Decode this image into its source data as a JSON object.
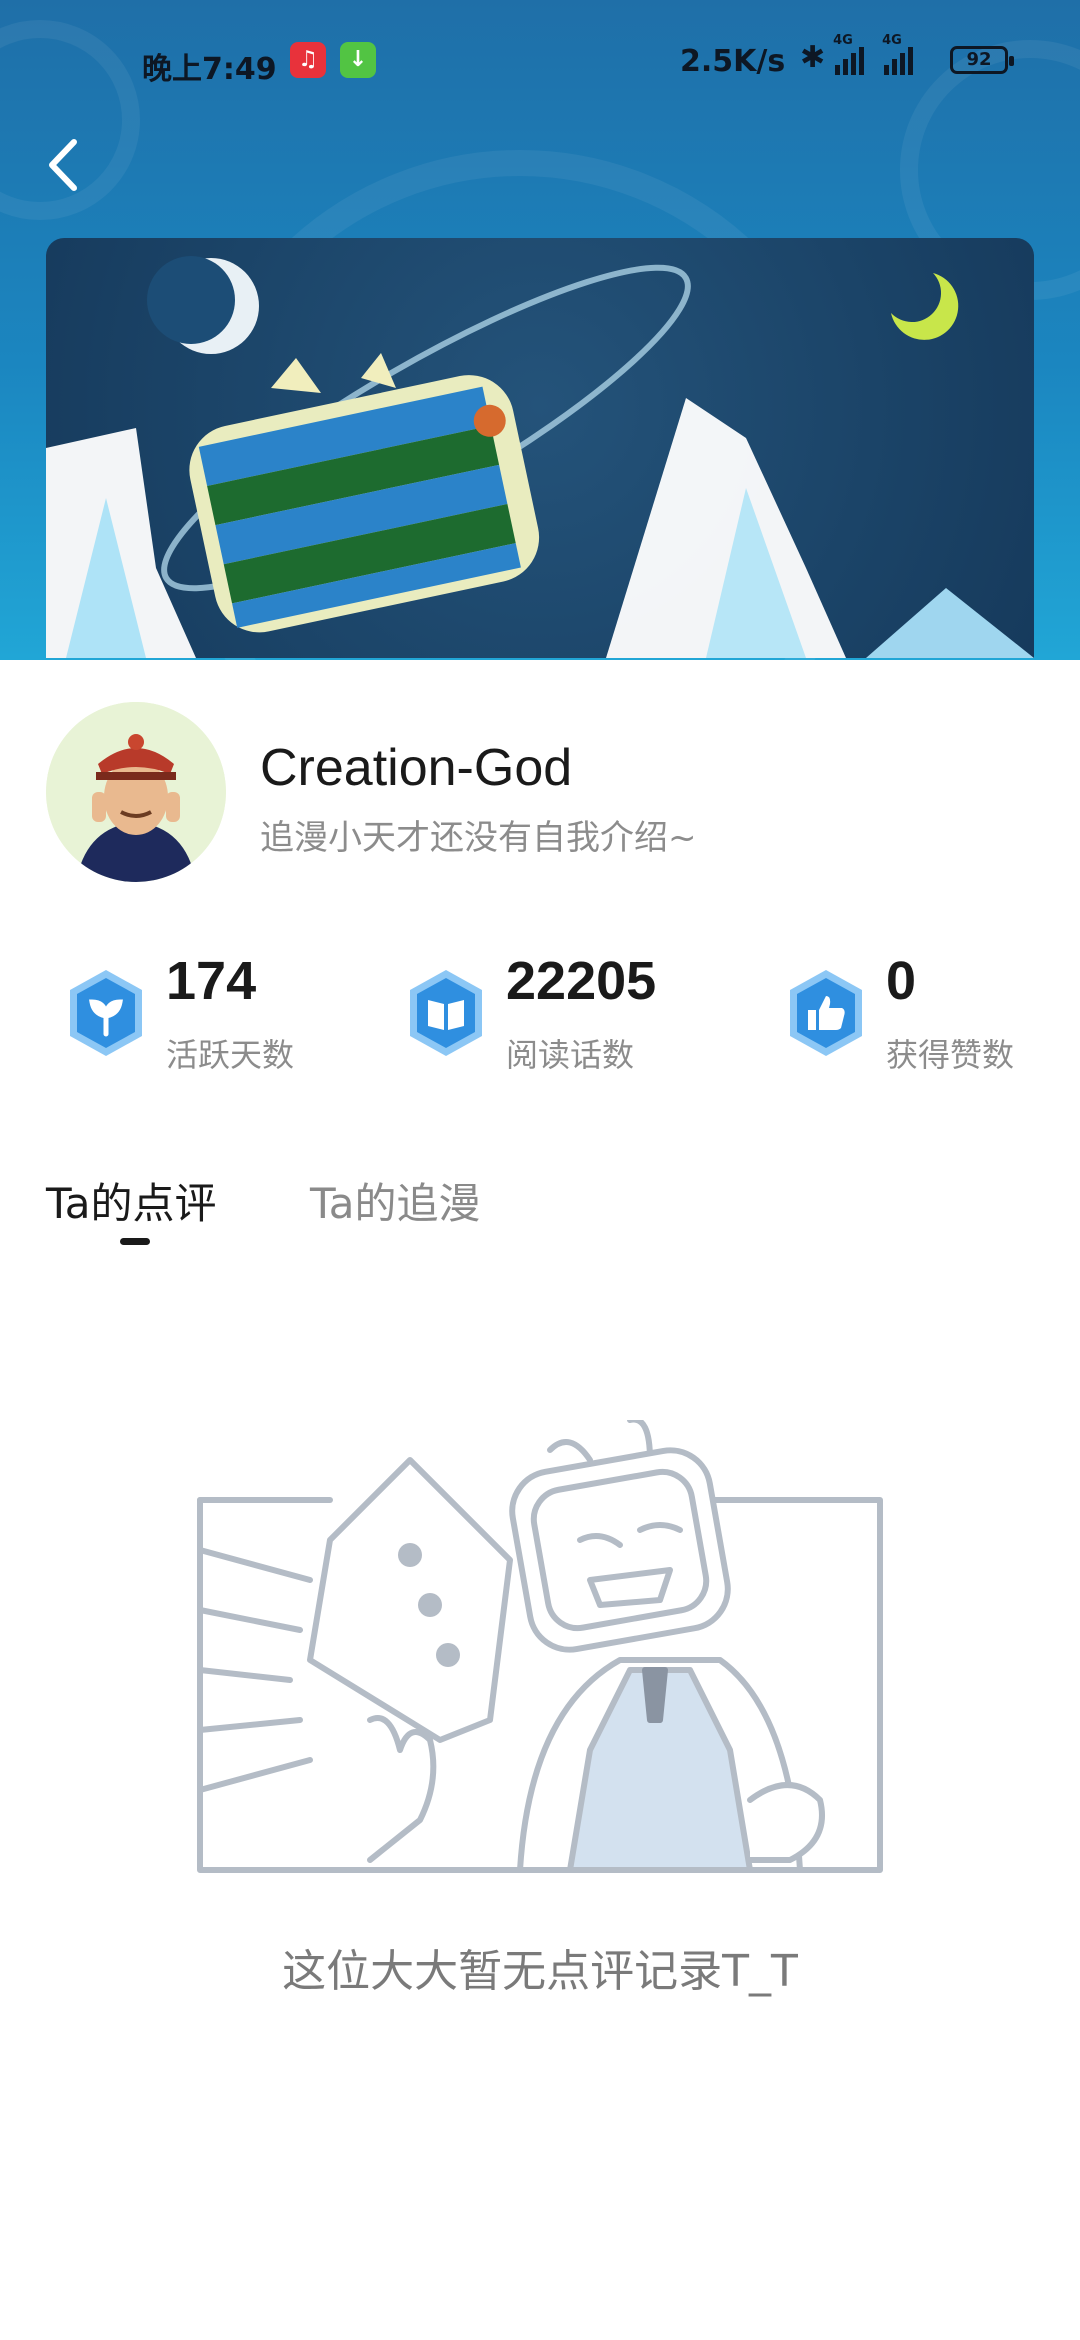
{
  "status_bar": {
    "time": "晚上7:49",
    "network_speed": "2.5K/s",
    "network_type": "4G",
    "battery": "92",
    "app_icons": [
      "netease-music-icon",
      "download-icon"
    ]
  },
  "header": {
    "back_icon": "chevron-left-icon",
    "banner_image": "bilibili-tv-planet-banner"
  },
  "profile": {
    "username": "Creation-God",
    "bio": "追漫小天才还没有自我介绍~",
    "avatar": "avatar-image"
  },
  "stats": [
    {
      "icon": "sprout-icon",
      "value": "174",
      "label": "活跃天数"
    },
    {
      "icon": "book-icon",
      "value": "22205",
      "label": "阅读话数"
    },
    {
      "icon": "thumbs-up-icon",
      "value": "0",
      "label": "获得赞数"
    }
  ],
  "tabs": [
    {
      "label": "Ta的点评",
      "active": true
    },
    {
      "label": "Ta的追漫",
      "active": false
    }
  ],
  "empty_state": {
    "illustration": "crying-tv-character-illustration",
    "message": "这位大大暂无点评记录T_T"
  },
  "colors": {
    "header_top": "#1f6fa8",
    "header_bottom": "#21a6d6",
    "stat_icon_blue": "#2f8fe0",
    "text_primary": "#1a1a1a",
    "text_secondary": "#8c8c8c"
  }
}
